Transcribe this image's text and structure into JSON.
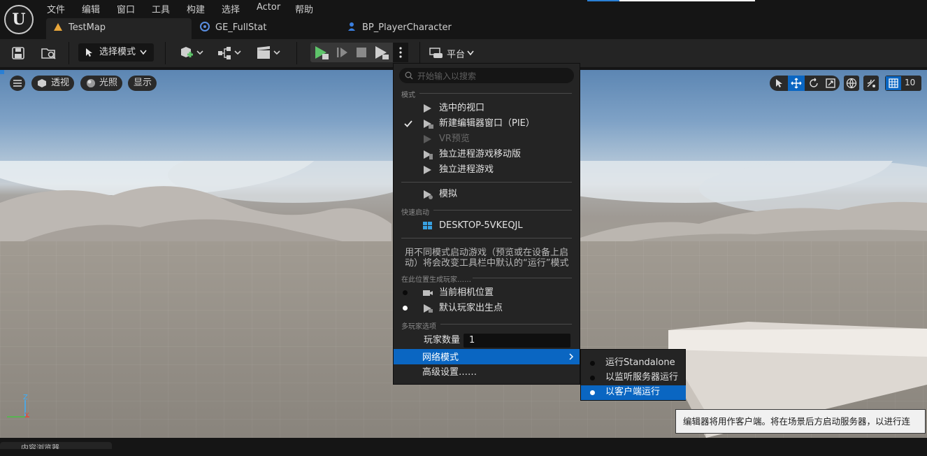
{
  "menu": [
    "文件",
    "编辑",
    "窗口",
    "工具",
    "构建",
    "选择",
    "Actor",
    "帮助"
  ],
  "tabs": [
    {
      "label": "TestMap",
      "active": true
    },
    {
      "label": "GE_FullStat",
      "active": false
    },
    {
      "label": "BP_PlayerCharacter",
      "active": false
    }
  ],
  "toolbar": {
    "mode_label": "选择模式",
    "platform_label": "平台"
  },
  "viewport": {
    "perspective_label": "透视",
    "lit_label": "光照",
    "show_label": "显示",
    "grid_value": "10"
  },
  "dropdown": {
    "search_placeholder": "开始输入以搜索",
    "modes_section": "模式",
    "modes": [
      {
        "label": "选中的视口",
        "checked": false,
        "disabled": false
      },
      {
        "label": "新建编辑器窗口（PIE）",
        "checked": true,
        "disabled": false
      },
      {
        "label": "VR预览",
        "checked": false,
        "disabled": true
      },
      {
        "label": "独立进程游戏移动版",
        "checked": false,
        "disabled": false
      },
      {
        "label": "独立进程游戏",
        "checked": false,
        "disabled": false
      }
    ],
    "simulate": "模拟",
    "quick_launch_section": "快速启动",
    "device": "DESKTOP-5VKEQJL",
    "info_line1": "用不同模式启动游戏（预览或在设备上启",
    "info_line2": "动）将会改变工具栏中默认的“运行”模式",
    "spawn_section": "在此位置生成玩家……",
    "spawn_options": [
      {
        "label": "当前相机位置",
        "selected": false
      },
      {
        "label": "默认玩家出生点",
        "selected": true
      }
    ],
    "multiplayer_section": "多玩家选项",
    "player_count_label": "玩家数量",
    "player_count_value": "1",
    "net_mode_label": "网络模式",
    "advanced_label": "高级设置……"
  },
  "submenu": [
    {
      "label": "运行Standalone",
      "selected": false
    },
    {
      "label": "以监听服务器运行",
      "selected": false
    },
    {
      "label": "以客户端运行",
      "selected": true
    }
  ],
  "tooltip": "编辑器将用作客户端。将在场景后方启动服务器，以进行连接。",
  "bottom_tab": "内容浏览器",
  "axis": {
    "z": "Z",
    "x": "X"
  },
  "colors": {
    "accent": "#0a66c2",
    "play_green": "#5ec46a",
    "panel": "#242424"
  }
}
